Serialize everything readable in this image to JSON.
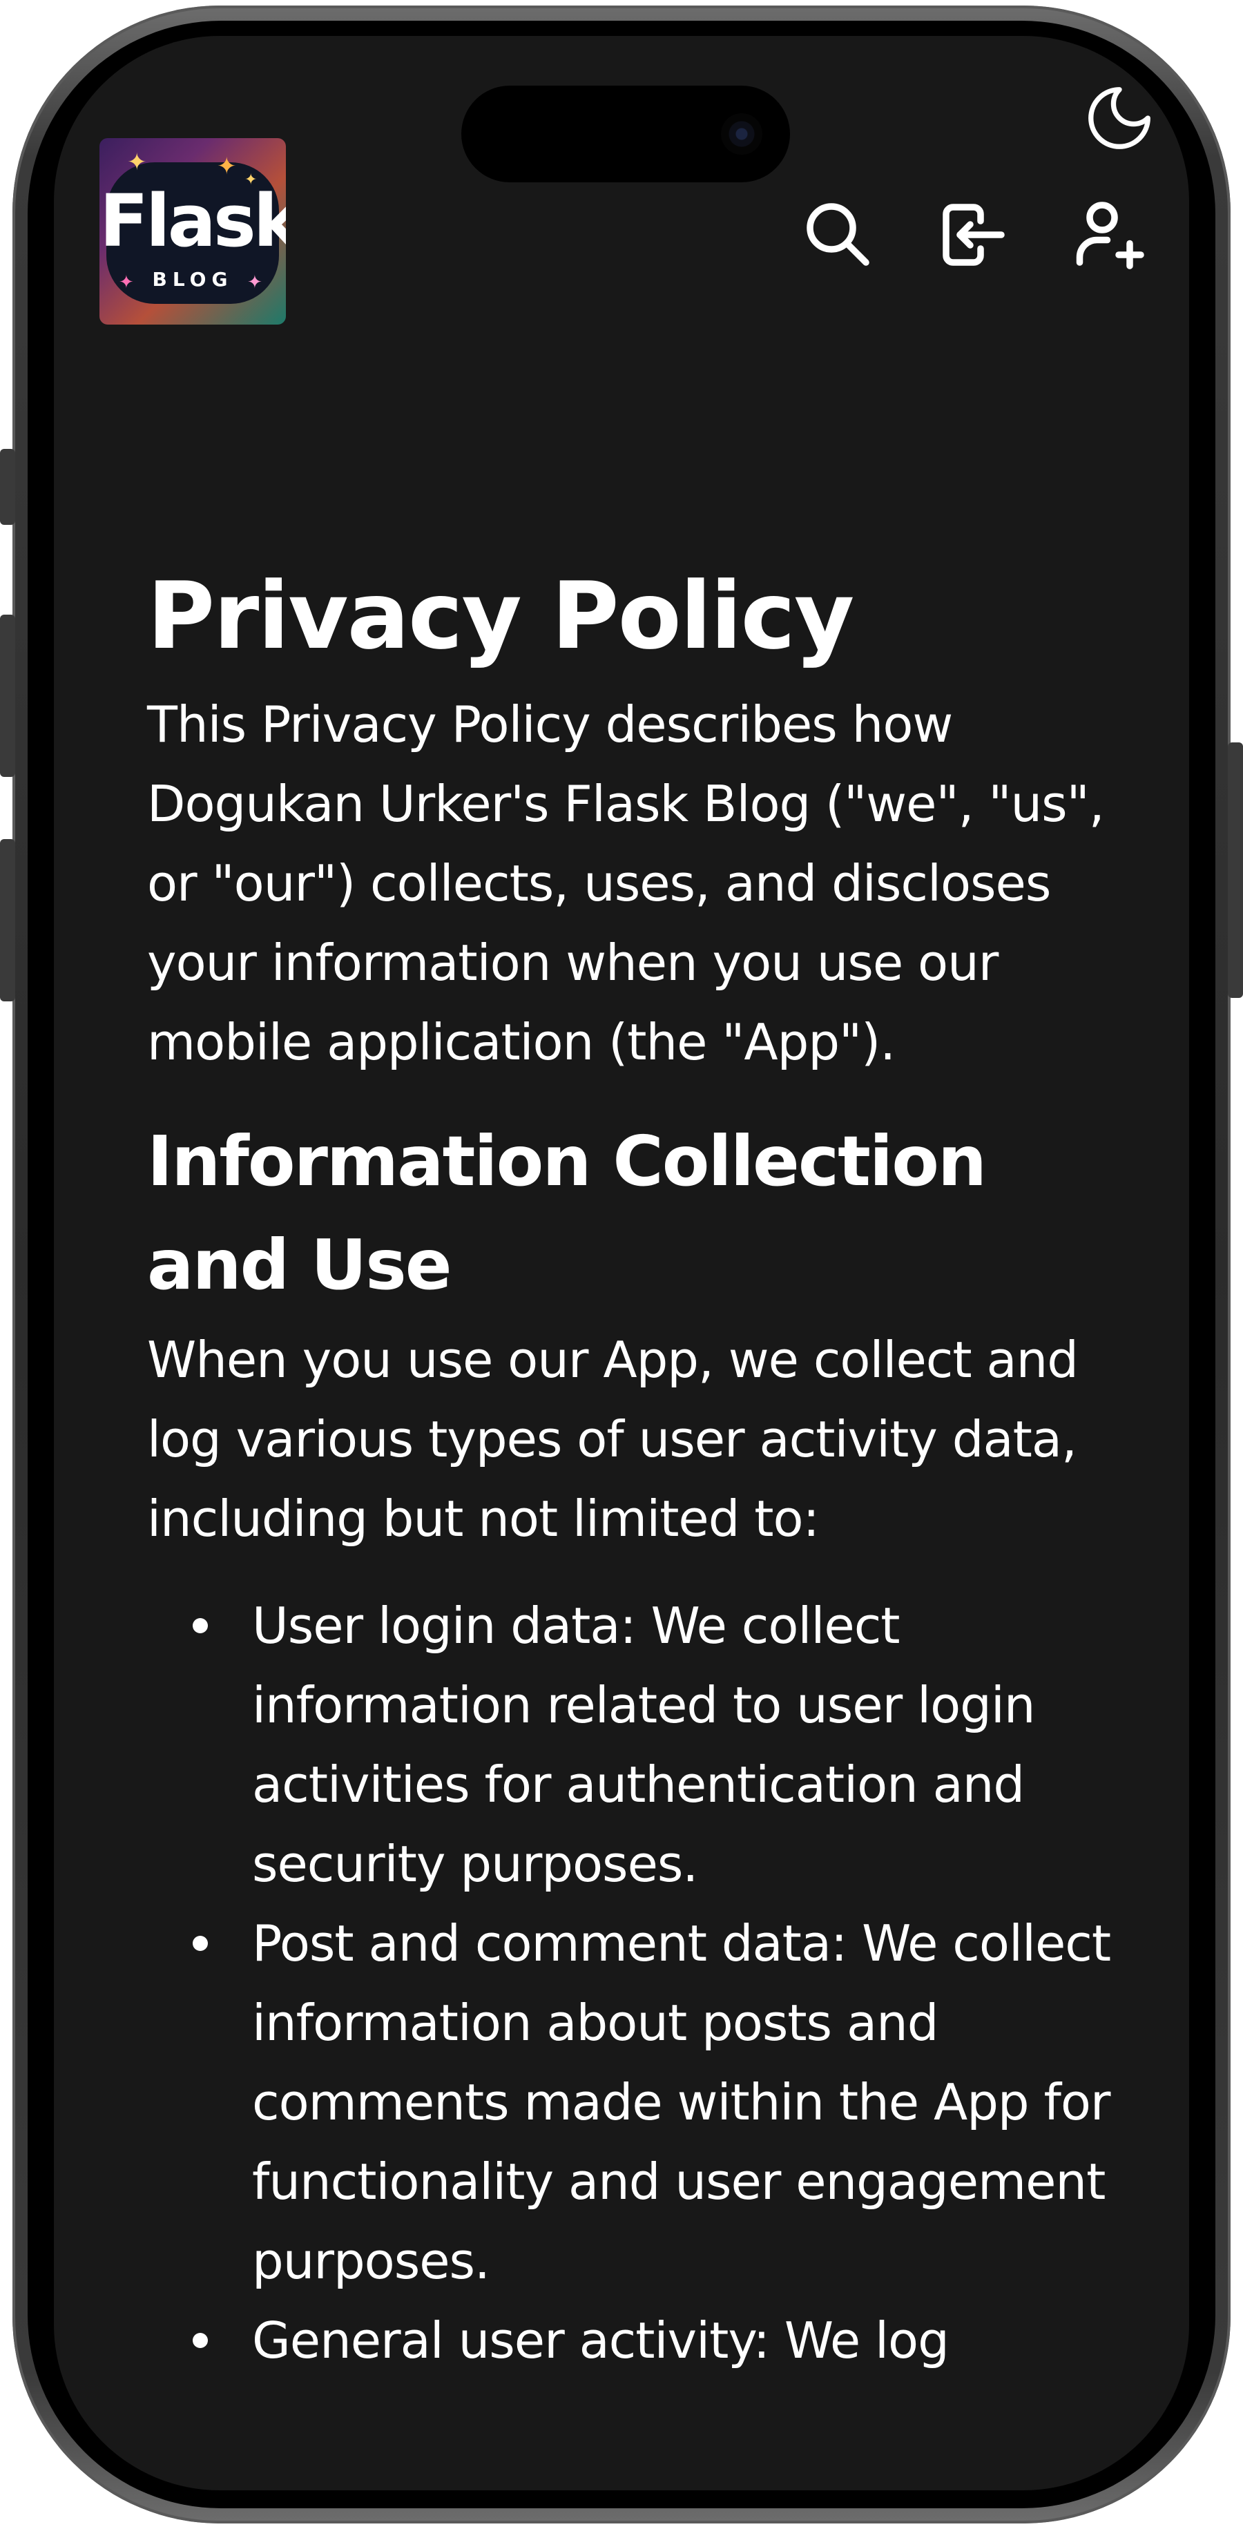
{
  "header": {
    "logo": {
      "title": "Flask",
      "subtitle": "BLOG"
    },
    "theme_toggle_icon": "moon-icon",
    "nav": [
      {
        "name": "search-button",
        "icon": "search-icon"
      },
      {
        "name": "login-button",
        "icon": "login-icon"
      },
      {
        "name": "signup-button",
        "icon": "user-plus-icon"
      }
    ]
  },
  "main": {
    "title": "Privacy Policy",
    "intro": "This Privacy Policy describes how Dogukan Urker's Flask Blog (\"we\", \"us\", or \"our\") collects, uses, and discloses your information when you use our mobile application (the \"App\").",
    "section": {
      "heading": "Information Collection and Use",
      "text": "When you use our App, we collect and log various types of user activity data, including but not limited to:",
      "items": [
        "User login data: We collect information related to user login activities for authentication and security purposes.",
        "Post and comment data: We collect information about posts and comments made within the App for functionality and user engagement purposes.",
        "General user activity: We log"
      ]
    }
  },
  "colors": {
    "background": "#181818",
    "text": "#ffffff",
    "frame": "#2b2b2b"
  }
}
